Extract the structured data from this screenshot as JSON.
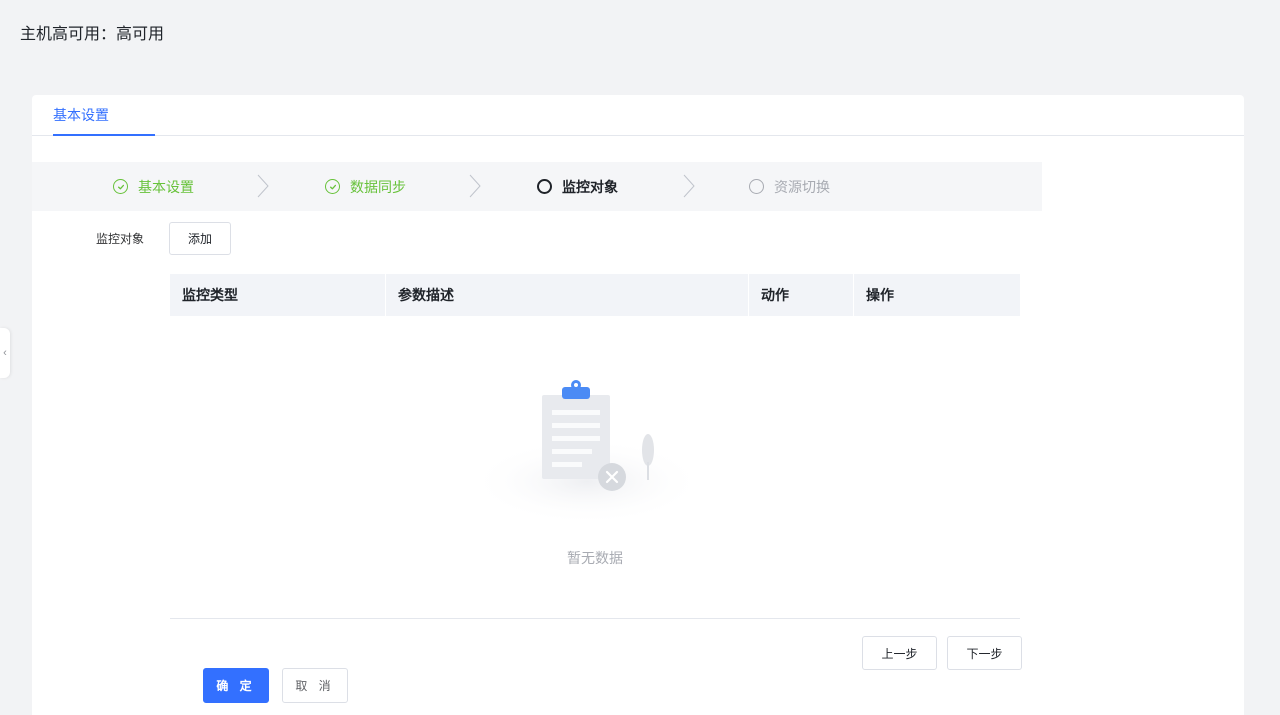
{
  "page": {
    "title": "主机高可用：高可用"
  },
  "tabs": [
    {
      "label": "基本设置",
      "active": true
    }
  ],
  "steps": [
    {
      "label": "基本设置",
      "status": "done"
    },
    {
      "label": "数据同步",
      "status": "done"
    },
    {
      "label": "监控对象",
      "status": "active"
    },
    {
      "label": "资源切换",
      "status": "pending"
    }
  ],
  "form": {
    "monitor_label": "监控对象",
    "add_button": "添加"
  },
  "table": {
    "columns": [
      "监控类型",
      "参数描述",
      "动作",
      "操作"
    ],
    "rows": [],
    "empty_text": "暂无数据"
  },
  "wizard": {
    "prev_label": "上一步",
    "next_label": "下一步"
  },
  "footer": {
    "confirm_label": "确 定",
    "cancel_label": "取 消"
  },
  "colors": {
    "primary": "#3370ff",
    "success": "#67c23a",
    "pending": "#a8abb2",
    "page_bg": "#f2f3f5"
  }
}
